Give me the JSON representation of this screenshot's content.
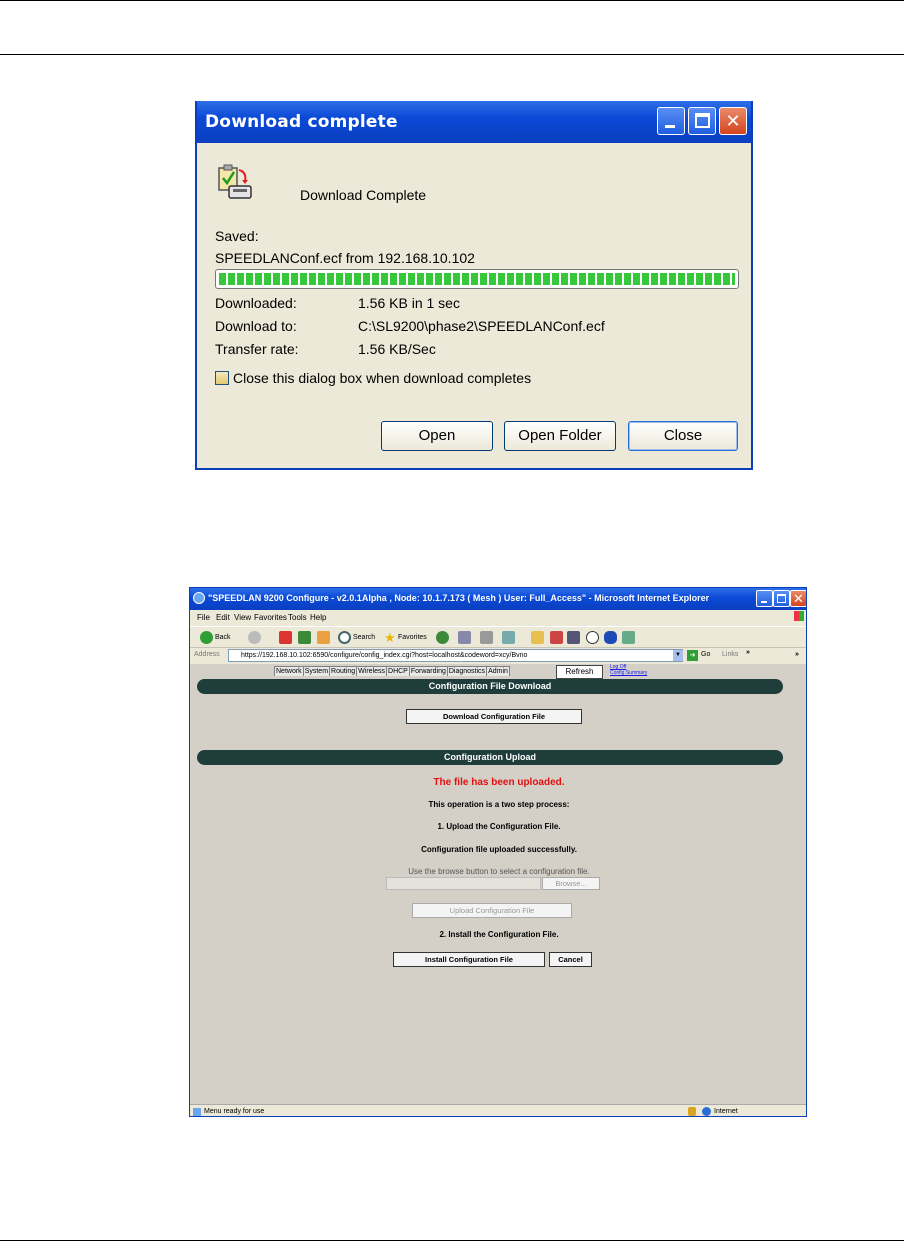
{
  "dialog": {
    "title": "Download complete",
    "heading": "Download Complete",
    "saved_label": "Saved:",
    "saved_file": "SPEEDLANConf.ecf from 192.168.10.102",
    "progress": 1.0,
    "rows": [
      {
        "label": "Downloaded:",
        "value": "1.56 KB in 1 sec"
      },
      {
        "label": "Download to:",
        "value": "C:\\SL9200\\phase2\\SPEEDLANConf.ecf"
      },
      {
        "label": "Transfer rate:",
        "value": "1.56 KB/Sec"
      }
    ],
    "checkbox_label": "Close this dialog box when download completes",
    "checkbox_checked": false,
    "buttons": {
      "open": "Open",
      "open_folder": "Open Folder",
      "close": "Close"
    }
  },
  "browser": {
    "title": "\"SPEEDLAN 9200 Configure - v2.0.1Alpha , Node: 10.1.7.173 ( Mesh ) User: Full_Access\" - Microsoft Internet Explorer",
    "menu": [
      "File",
      "Edit",
      "View",
      "Favorites",
      "Tools",
      "Help"
    ],
    "toolbar": {
      "back": "Back",
      "search": "Search",
      "favorites": "Favorites"
    },
    "address_label": "Address",
    "address_value": "https://192.168.10.102:6590/configure/config_index.cgi?host=localhost&codeword=xcy/Bvno",
    "go_label": "Go",
    "links_label": "Links",
    "tabs": [
      "Network",
      "System",
      "Routing",
      "Wireless",
      "DHCP",
      "Forwarding",
      "Diagnostics",
      "Admin"
    ],
    "refresh_label": "Refresh",
    "logoff_label": "Log Off",
    "config_summary_label": "Config Summary",
    "download_section": {
      "title": "Configuration File Download",
      "button": "Download Configuration File"
    },
    "upload_section": {
      "title": "Configuration Upload",
      "status": "The file has been uploaded.",
      "intro": "This operation is a two step process:",
      "step1": "1. Upload the Configuration File.",
      "step1_result": "Configuration file uploaded successfully.",
      "browse_hint": "Use the browse button to select a configuration file.",
      "browse_button": "Browse...",
      "upload_button": "Upload Configuration File",
      "step2": "2. Install the Configuration File.",
      "install_button": "Install Configuration File",
      "cancel_button": "Cancel"
    },
    "status_text": "Menu ready for use",
    "zone_text": "Internet"
  },
  "colors": {
    "status_red": "#e01010",
    "section_bar": "#1f3d3a",
    "xp_blue": "#0b49d6"
  }
}
